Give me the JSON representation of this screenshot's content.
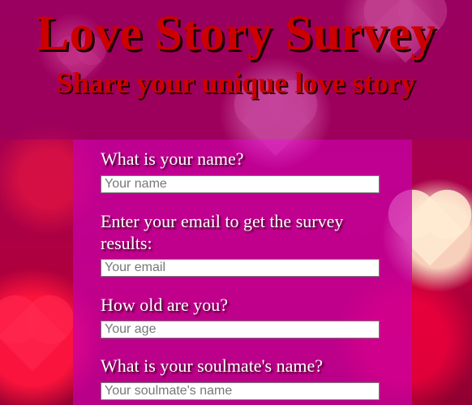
{
  "header": {
    "title": "Love Story Survey",
    "subtitle": "Share your unique love story"
  },
  "form": {
    "questions": [
      {
        "label": "What is your name?",
        "placeholder": "Your name"
      },
      {
        "label": "Enter your email to get the survey results:",
        "placeholder": "Your email"
      },
      {
        "label": "How old are you?",
        "placeholder": "Your age"
      },
      {
        "label": "What is your soulmate's name?",
        "placeholder": "Your soulmate's name"
      }
    ]
  },
  "colors": {
    "title": "#cc0000",
    "panel": "#c800aa",
    "header_overlay": "#960064"
  }
}
